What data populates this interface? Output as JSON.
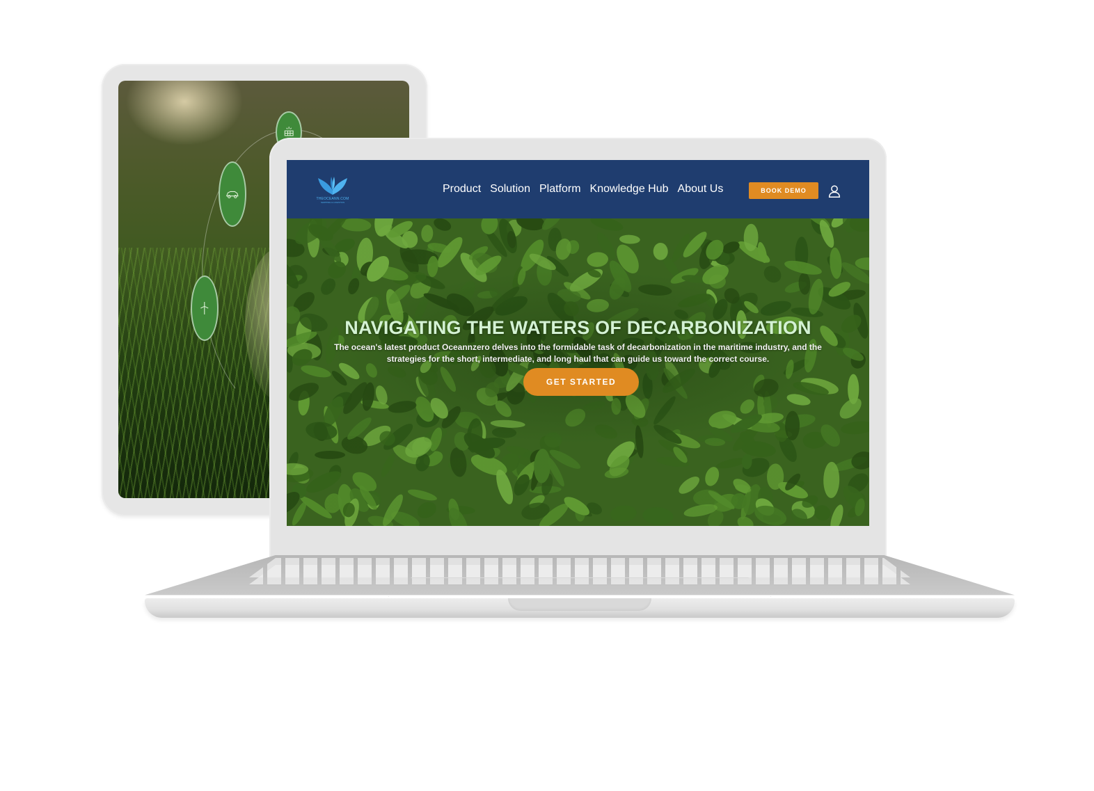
{
  "colors": {
    "nav_bg": "#1f3d6f",
    "accent": "#e08b22",
    "hero_title": "#d4f2d4",
    "logo": "#4fb3f0",
    "device_frame": "#e4e4e4"
  },
  "tablet": {
    "icons": [
      "solar-panel-icon",
      "car-icon",
      "wind-turbine-icon"
    ]
  },
  "site": {
    "logo": {
      "name": "THEOCEANN.COM",
      "tagline": "SHIPPING & LOGISTICS"
    },
    "nav": {
      "items": [
        {
          "label": "Product"
        },
        {
          "label": "Solution"
        },
        {
          "label": "Platform"
        },
        {
          "label": "Knowledge Hub"
        },
        {
          "label": "About Us"
        }
      ],
      "book_demo_label": "BOOK DEMO",
      "user_icon": "user-icon"
    },
    "hero": {
      "title": "NAVIGATING THE WATERS OF DECARBONIZATION",
      "description": "The ocean's latest product Oceannzero delves into the formidable task of decarbonization in the maritime industry, and the strategies for the short, intermediate, and long haul that can guide us toward the correct course.",
      "cta_label": "GET STARTED"
    }
  }
}
